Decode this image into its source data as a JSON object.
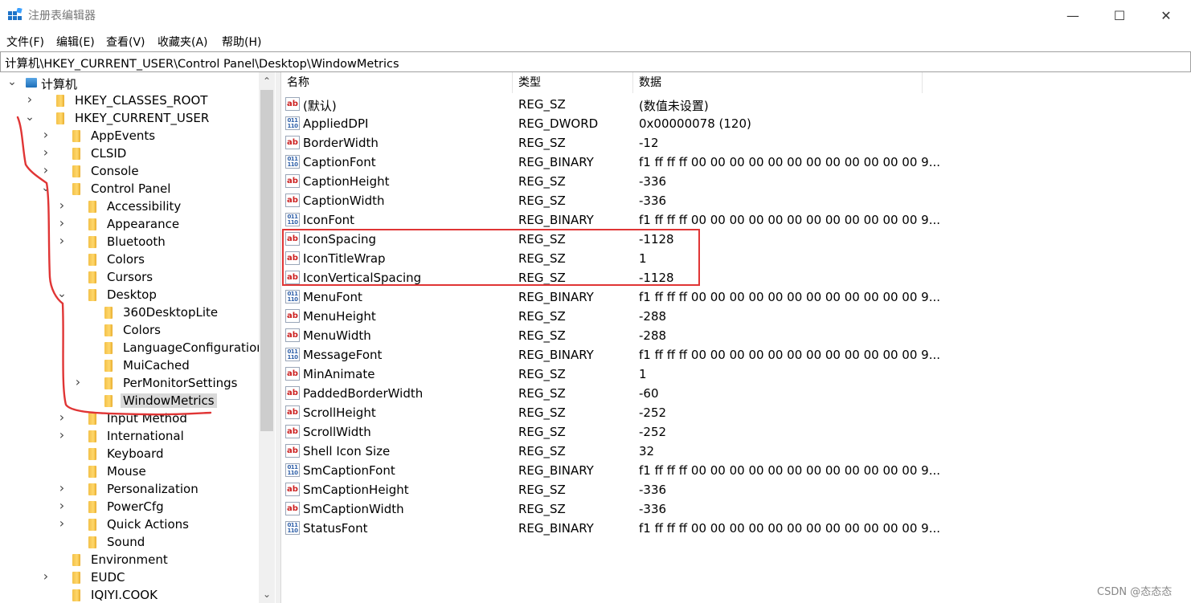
{
  "window": {
    "title": "注册表编辑器",
    "min_glyph": "—",
    "max_glyph": "☐",
    "close_glyph": "✕"
  },
  "menu": [
    "文件(F)",
    "编辑(E)",
    "查看(V)",
    "收藏夹(A)",
    "帮助(H)"
  ],
  "address": "计算机\\HKEY_CURRENT_USER\\Control Panel\\Desktop\\WindowMetrics",
  "tree": [
    {
      "label": "计算机",
      "level": 0,
      "expander": "open",
      "kind": "computer"
    },
    {
      "label": "HKEY_CLASSES_ROOT",
      "level": 1,
      "expander": "closed"
    },
    {
      "label": "HKEY_CURRENT_USER",
      "level": 1,
      "expander": "open"
    },
    {
      "label": "AppEvents",
      "level": 2,
      "expander": "closed"
    },
    {
      "label": "CLSID",
      "level": 2,
      "expander": "closed"
    },
    {
      "label": "Console",
      "level": 2,
      "expander": "closed"
    },
    {
      "label": "Control Panel",
      "level": 2,
      "expander": "open"
    },
    {
      "label": "Accessibility",
      "level": 3,
      "expander": "closed"
    },
    {
      "label": "Appearance",
      "level": 3,
      "expander": "closed"
    },
    {
      "label": "Bluetooth",
      "level": 3,
      "expander": "closed"
    },
    {
      "label": "Colors",
      "level": 3,
      "expander": "none"
    },
    {
      "label": "Cursors",
      "level": 3,
      "expander": "none"
    },
    {
      "label": "Desktop",
      "level": 3,
      "expander": "open"
    },
    {
      "label": "360DesktopLite",
      "level": 4,
      "expander": "none"
    },
    {
      "label": "Colors",
      "level": 4,
      "expander": "none"
    },
    {
      "label": "LanguageConfiguration",
      "level": 4,
      "expander": "none"
    },
    {
      "label": "MuiCached",
      "level": 4,
      "expander": "none"
    },
    {
      "label": "PerMonitorSettings",
      "level": 4,
      "expander": "closed"
    },
    {
      "label": "WindowMetrics",
      "level": 4,
      "expander": "none",
      "selected": true
    },
    {
      "label": "Input Method",
      "level": 3,
      "expander": "closed"
    },
    {
      "label": "International",
      "level": 3,
      "expander": "closed"
    },
    {
      "label": "Keyboard",
      "level": 3,
      "expander": "none"
    },
    {
      "label": "Mouse",
      "level": 3,
      "expander": "none"
    },
    {
      "label": "Personalization",
      "level": 3,
      "expander": "closed"
    },
    {
      "label": "PowerCfg",
      "level": 3,
      "expander": "closed"
    },
    {
      "label": "Quick Actions",
      "level": 3,
      "expander": "closed"
    },
    {
      "label": "Sound",
      "level": 3,
      "expander": "none"
    },
    {
      "label": "Environment",
      "level": 2,
      "expander": "none"
    },
    {
      "label": "EUDC",
      "level": 2,
      "expander": "closed"
    },
    {
      "label": "IQIYI.COOK",
      "level": 2,
      "expander": "none"
    }
  ],
  "list": {
    "columns": [
      "名称",
      "类型",
      "数据"
    ],
    "rows": [
      {
        "name": "(默认)",
        "type": "REG_SZ",
        "data": "(数值未设置)",
        "icon": "ab"
      },
      {
        "name": "AppliedDPI",
        "type": "REG_DWORD",
        "data": "0x00000078 (120)",
        "icon": "bin"
      },
      {
        "name": "BorderWidth",
        "type": "REG_SZ",
        "data": "-12",
        "icon": "ab"
      },
      {
        "name": "CaptionFont",
        "type": "REG_BINARY",
        "data": "f1 ff ff ff 00 00 00 00 00 00 00 00 00 00 00 00 9...",
        "icon": "bin"
      },
      {
        "name": "CaptionHeight",
        "type": "REG_SZ",
        "data": "-336",
        "icon": "ab"
      },
      {
        "name": "CaptionWidth",
        "type": "REG_SZ",
        "data": "-336",
        "icon": "ab"
      },
      {
        "name": "IconFont",
        "type": "REG_BINARY",
        "data": "f1 ff ff ff 00 00 00 00 00 00 00 00 00 00 00 00 9...",
        "icon": "bin"
      },
      {
        "name": "IconSpacing",
        "type": "REG_SZ",
        "data": "-1128",
        "icon": "ab"
      },
      {
        "name": "IconTitleWrap",
        "type": "REG_SZ",
        "data": "1",
        "icon": "ab"
      },
      {
        "name": "IconVerticalSpacing",
        "type": "REG_SZ",
        "data": "-1128",
        "icon": "ab"
      },
      {
        "name": "MenuFont",
        "type": "REG_BINARY",
        "data": "f1 ff ff ff 00 00 00 00 00 00 00 00 00 00 00 00 9...",
        "icon": "bin"
      },
      {
        "name": "MenuHeight",
        "type": "REG_SZ",
        "data": "-288",
        "icon": "ab"
      },
      {
        "name": "MenuWidth",
        "type": "REG_SZ",
        "data": "-288",
        "icon": "ab"
      },
      {
        "name": "MessageFont",
        "type": "REG_BINARY",
        "data": "f1 ff ff ff 00 00 00 00 00 00 00 00 00 00 00 00 9...",
        "icon": "bin"
      },
      {
        "name": "MinAnimate",
        "type": "REG_SZ",
        "data": "1",
        "icon": "ab"
      },
      {
        "name": "PaddedBorderWidth",
        "type": "REG_SZ",
        "data": "-60",
        "icon": "ab"
      },
      {
        "name": "ScrollHeight",
        "type": "REG_SZ",
        "data": "-252",
        "icon": "ab"
      },
      {
        "name": "ScrollWidth",
        "type": "REG_SZ",
        "data": "-252",
        "icon": "ab"
      },
      {
        "name": "Shell Icon Size",
        "type": "REG_SZ",
        "data": "32",
        "icon": "ab"
      },
      {
        "name": "SmCaptionFont",
        "type": "REG_BINARY",
        "data": "f1 ff ff ff 00 00 00 00 00 00 00 00 00 00 00 00 9...",
        "icon": "bin"
      },
      {
        "name": "SmCaptionHeight",
        "type": "REG_SZ",
        "data": "-336",
        "icon": "ab"
      },
      {
        "name": "SmCaptionWidth",
        "type": "REG_SZ",
        "data": "-336",
        "icon": "ab"
      },
      {
        "name": "StatusFont",
        "type": "REG_BINARY",
        "data": "f1 ff ff ff 00 00 00 00 00 00 00 00 00 00 00 00 9...",
        "icon": "bin"
      }
    ]
  },
  "icon_glyphs": {
    "ab": "ab",
    "bin": "011 110"
  },
  "watermark": "CSDN @态态态",
  "colors": {
    "highlight": "#e03535",
    "selection": "#d9d9d9",
    "folder": "#f3c14a"
  }
}
